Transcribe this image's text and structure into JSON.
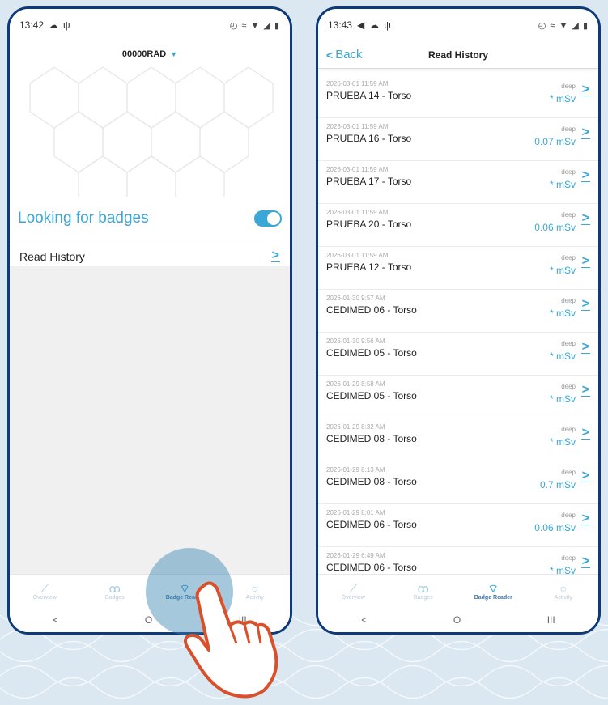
{
  "left": {
    "status_time": "13:42",
    "device_name": "00000RAD",
    "looking_label": "Looking for badges",
    "toggle_on": true,
    "menu_item": "Read History",
    "tabs": [
      {
        "label": "Overview",
        "icon": "chart-line-icon",
        "active": false
      },
      {
        "label": "Badges",
        "icon": "badges-icon",
        "active": false
      },
      {
        "label": "Badge Reader",
        "icon": "wifi-icon",
        "active": true
      },
      {
        "label": "Activity",
        "icon": "activity-icon",
        "active": false
      }
    ],
    "nav": [
      "<",
      "O",
      "III"
    ]
  },
  "right": {
    "status_time": "13:43",
    "back_label": "Back",
    "title": "Read History",
    "rows": [
      {
        "timestamp": "2026-03-01 11:59 AM",
        "name": "PRUEBA 14 - Torso",
        "type": "deep",
        "dose": "* mSv"
      },
      {
        "timestamp": "2026-03-01 11:59 AM",
        "name": "PRUEBA 16 - Torso",
        "type": "deep",
        "dose": "0.07 mSv"
      },
      {
        "timestamp": "2026-03-01 11:59 AM",
        "name": "PRUEBA 17 - Torso",
        "type": "deep",
        "dose": "* mSv"
      },
      {
        "timestamp": "2026-03-01 11:59 AM",
        "name": "PRUEBA 20 - Torso",
        "type": "deep",
        "dose": "0.06 mSv"
      },
      {
        "timestamp": "2026-03-01 11:59 AM",
        "name": "PRUEBA 12 - Torso",
        "type": "deep",
        "dose": "* mSv"
      },
      {
        "timestamp": "2026-01-30 9:57 AM",
        "name": "CEDIMED 06 - Torso",
        "type": "deep",
        "dose": "* mSv"
      },
      {
        "timestamp": "2026-01-30 9:56 AM",
        "name": "CEDIMED 05 - Torso",
        "type": "deep",
        "dose": "* mSv"
      },
      {
        "timestamp": "2026-01-29 8:58 AM",
        "name": "CEDIMED 05 - Torso",
        "type": "deep",
        "dose": "* mSv"
      },
      {
        "timestamp": "2026-01-29 8:32 AM",
        "name": "CEDIMED 08 - Torso",
        "type": "deep",
        "dose": "* mSv"
      },
      {
        "timestamp": "2026-01-29 8:13 AM",
        "name": "CEDIMED 08 - Torso",
        "type": "deep",
        "dose": "0.7 mSv"
      },
      {
        "timestamp": "2026-01-29 8:01 AM",
        "name": "CEDIMED 06 - Torso",
        "type": "deep",
        "dose": "0.06 mSv"
      },
      {
        "timestamp": "2026-01-29 6:49 AM",
        "name": "CEDIMED 06 - Torso",
        "type": "deep",
        "dose": "* mSv"
      }
    ],
    "tabs": [
      {
        "label": "Overview",
        "icon": "chart-line-icon",
        "active": false
      },
      {
        "label": "Badges",
        "icon": "badges-icon",
        "active": false
      },
      {
        "label": "Badge Reader",
        "icon": "wifi-icon",
        "active": true
      },
      {
        "label": "Activity",
        "icon": "activity-icon",
        "active": false
      }
    ],
    "nav": [
      "<",
      "O",
      "III"
    ]
  },
  "colors": {
    "accent": "#3aa7d6",
    "frame": "#0d3a78",
    "background": "#dbe8f1",
    "hand": "#d9502a"
  }
}
